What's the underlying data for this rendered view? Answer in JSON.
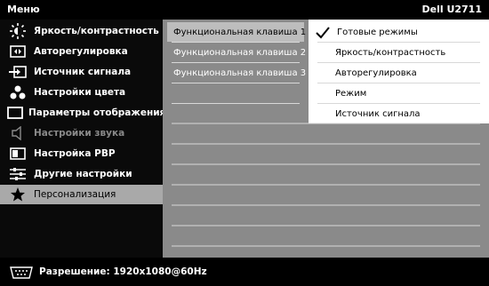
{
  "header": {
    "title": "Меню",
    "brand": "Dell U2711"
  },
  "menu": {
    "items": [
      {
        "label": "Яркость/контрастность",
        "icon": "brightness-icon"
      },
      {
        "label": "Авторегулировка",
        "icon": "auto-adjust-icon"
      },
      {
        "label": "Источник сигнала",
        "icon": "input-source-icon"
      },
      {
        "label": "Настройки цвета",
        "icon": "color-settings-icon"
      },
      {
        "label": "Параметры отображения",
        "icon": "display-settings-icon"
      },
      {
        "label": "Настройки звука",
        "icon": "speaker-icon"
      },
      {
        "label": "Настройка PBP",
        "icon": "pbp-icon"
      },
      {
        "label": "Другие настройки",
        "icon": "sliders-icon"
      },
      {
        "label": "Персонализация",
        "icon": "star-icon"
      }
    ]
  },
  "submenu": {
    "items": [
      {
        "label": "Функциональная клавиша 1"
      },
      {
        "label": "Функциональная клавиша 2"
      },
      {
        "label": "Функциональная клавиша 3"
      }
    ]
  },
  "options": {
    "items": [
      {
        "label": "Готовые режимы"
      },
      {
        "label": "Яркость/контрастность"
      },
      {
        "label": "Авторегулировка"
      },
      {
        "label": "Режим"
      },
      {
        "label": "Источник сигнала"
      }
    ]
  },
  "footer": {
    "resolution": "Разрешение: 1920x1080@60Hz"
  },
  "colors": {
    "panel": "#8a8a8a",
    "selected": "#a9a9a9",
    "background": "#000000"
  }
}
